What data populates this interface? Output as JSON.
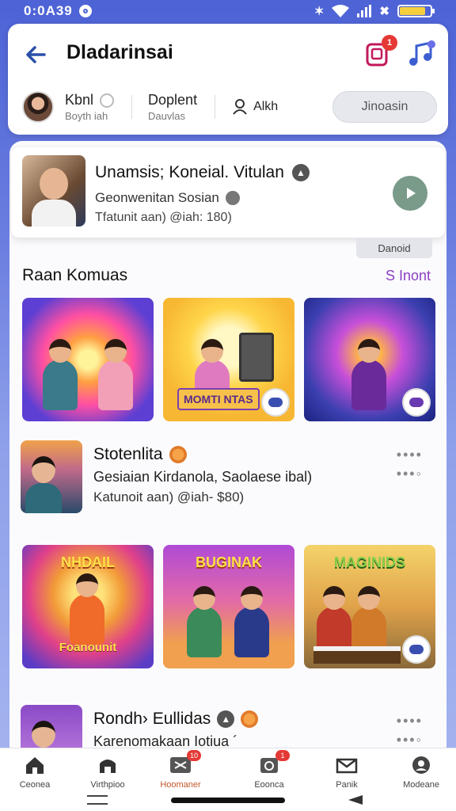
{
  "status_bar": {
    "time": "0:0A39",
    "icons": [
      "bluetooth-icon",
      "wifi-icon",
      "signal-icon",
      "cast-icon",
      "battery-icon"
    ],
    "battery_fill": 0.85
  },
  "header": {
    "title": "Dladarinsai",
    "notification_count": "1",
    "user": {
      "name": "Kbnl",
      "sub": "Boyth iah"
    },
    "stat": {
      "value": "Doplent",
      "label": "Dauvlas"
    },
    "auth_label": "Alkh",
    "join_label": "Jinoasin"
  },
  "featured": {
    "title": "Unamsis; Koneial.  Vitulan",
    "subtitle": "Geonwenitan Sosian",
    "meta": "Tfatunit aan) @iah: 180)"
  },
  "tag_pill": "Danoid",
  "section": {
    "title": "Raan Komuas",
    "see_all": "S Inont"
  },
  "tiles_row1": [
    {
      "label": ""
    },
    {
      "label": "MOMTI NTAS"
    },
    {
      "label": ""
    }
  ],
  "list_item_1": {
    "title": "Stotenlita",
    "subtitle": "Gesiaian Kirdanola, Saolaese ibal)",
    "meta": "Katunoit aan) @iah- $80)"
  },
  "tiles_row2": [
    {
      "top": "NHDAIL",
      "bottom": "Foanounit"
    },
    {
      "top": "BUGINAK",
      "bottom": ""
    },
    {
      "top": "MAGINIDS",
      "bottom": ""
    }
  ],
  "list_item_2": {
    "title": "Rondh› Eullidas",
    "subtitle": "Karenomakaan Iotiua ´"
  },
  "bottom_nav": [
    {
      "label": "Ceonea",
      "icon": "home-icon",
      "badge": ""
    },
    {
      "label": "Virthpioo",
      "icon": "house-icon",
      "badge": ""
    },
    {
      "label": "Hoomaner",
      "icon": "scissors-icon",
      "badge": "10",
      "active": true
    },
    {
      "label": "Eoonca",
      "icon": "calendar-icon",
      "badge": "1"
    },
    {
      "label": "Panik",
      "icon": "mail-icon",
      "badge": ""
    },
    {
      "label": "Modeane",
      "icon": "profile-icon",
      "badge": ""
    }
  ],
  "colors": {
    "accent": "#2a4fa8",
    "link": "#8a3fc4",
    "active_nav": "#c4572a",
    "badge": "#e53935"
  }
}
